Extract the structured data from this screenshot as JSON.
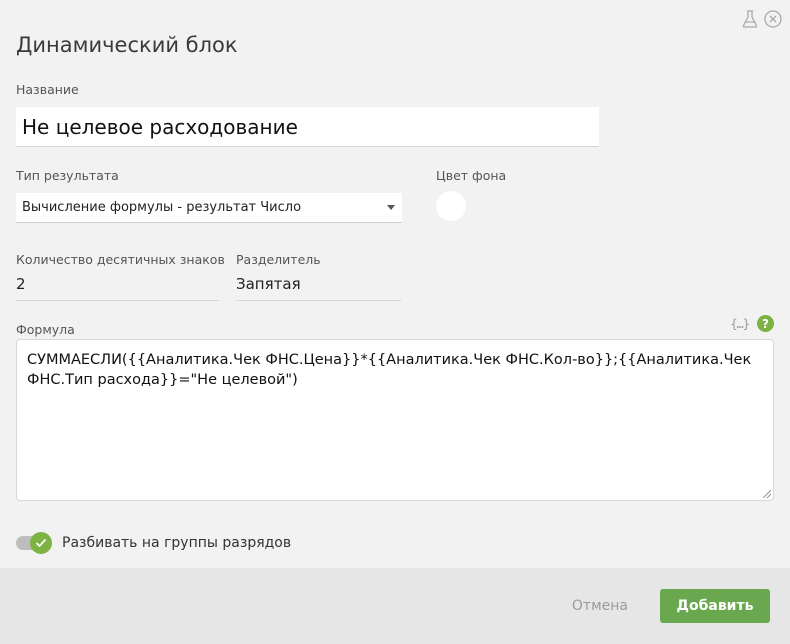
{
  "dialog": {
    "title": "Динамический блок",
    "name_label": "Название",
    "name_value": "Не целевое расходование",
    "result_type_label": "Тип результата",
    "result_type_value": "Вычисление формулы - результат Число",
    "bg_color_label": "Цвет фона",
    "decimals_label": "Количество десятичных знаков",
    "decimals_value": "2",
    "separator_label": "Разделитель",
    "separator_value": "Запятая",
    "formula_label": "Формула",
    "formula_value": "СУММАЕСЛИ({{Аналитика.Чек ФНС.Цена}}*{{Аналитика.Чек ФНС.Кол-во}};{{Аналитика.Чек ФНС.Тип расхода}}=\"Не целевой\")",
    "digit_groups_label": "Разбивать на группы разрядов",
    "digit_groups_enabled": true,
    "bg_color": "#ffffff",
    "accent_color": "#6aa84f"
  },
  "icons": {
    "flask": "flask-icon",
    "close": "close-icon",
    "braces": "{…}",
    "help": "?"
  },
  "footer": {
    "cancel_label": "Отмена",
    "add_label": "Добавить"
  }
}
